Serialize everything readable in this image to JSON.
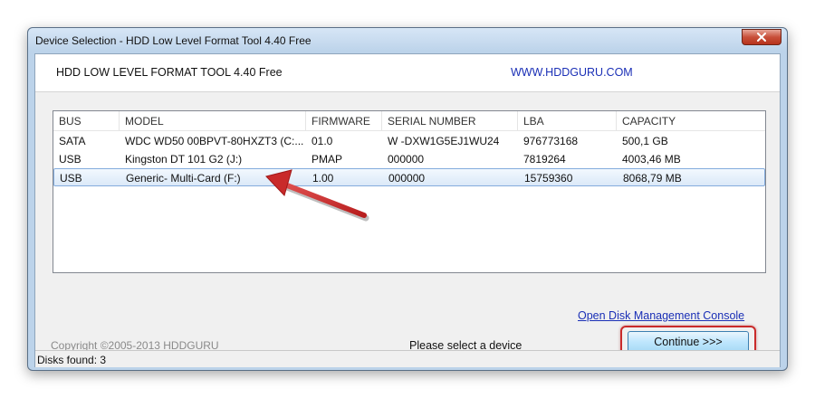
{
  "window": {
    "title": "Device Selection - HDD Low Level Format Tool 4.40    Free"
  },
  "header": {
    "app_name": "HDD LOW LEVEL FORMAT TOOL 4.40    Free",
    "url": "WWW.HDDGURU.COM"
  },
  "device_list": {
    "columns": [
      "BUS",
      "MODEL",
      "FIRMWARE",
      "SERIAL NUMBER",
      "LBA",
      "CAPACITY"
    ],
    "rows": [
      {
        "bus": "SATA",
        "model": "WDC WD50 00BPVT-80HXZT3 (C:...",
        "firmware": "01.0",
        "serial": "W -DXW1G5EJ1WU24",
        "lba": "976773168",
        "capacity": "500,1 GB",
        "selected": false
      },
      {
        "bus": "USB",
        "model": "Kingston DT 101 G2 (J:)",
        "firmware": "PMAP",
        "serial": "000000",
        "lba": "7819264",
        "capacity": "4003,46 MB",
        "selected": false
      },
      {
        "bus": "USB",
        "model": "Generic- Multi-Card (F:)",
        "firmware": "1.00",
        "serial": "000000",
        "lba": "15759360",
        "capacity": "8068,79 MB",
        "selected": true
      }
    ]
  },
  "links": {
    "disk_management": "Open Disk Management Console"
  },
  "footer": {
    "copyright": "Copyright ©2005-2013 HDDGURU",
    "status_message": "Please select a device",
    "continue_label": "Continue >>>"
  },
  "statusbar": {
    "disks_found": "Disks found: 3"
  },
  "colors": {
    "link": "#1a2fb6",
    "annotation_red": "#c92a2a",
    "selection": "#dbe9f8"
  },
  "icons": {
    "close": "close-icon",
    "annotation": "red-arrow-annotation"
  }
}
